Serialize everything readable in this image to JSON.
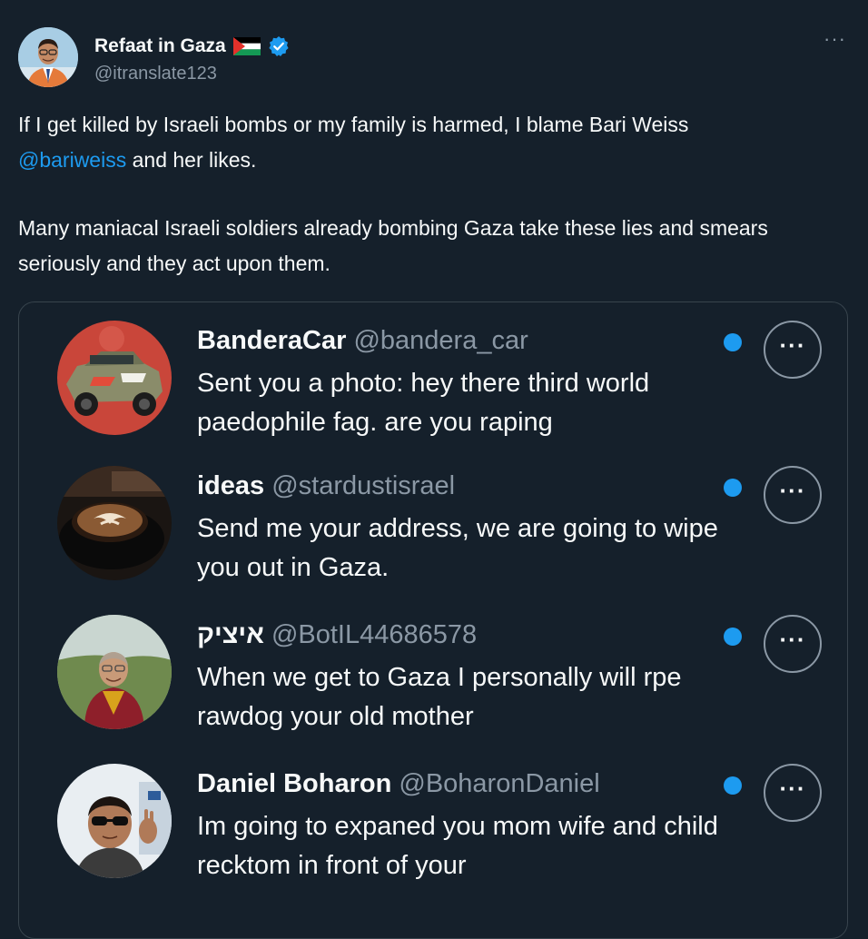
{
  "tweet": {
    "author": {
      "display_name": "Refaat in Gaza",
      "handle": "@itranslate123",
      "flag_icon": "palestine-flag",
      "verified_icon": "verified-badge-icon"
    },
    "more_icon": "···",
    "text": {
      "line1": "If I get killed by Israeli bombs or my family is harmed, I blame Bari Weiss",
      "mention": "@bariweiss",
      "line2_rest": " and her likes.",
      "para2": "Many maniacal Israeli soldiers already bombing Gaza take these lies and smears seriously and they act upon them."
    },
    "colors": {
      "background": "#15202b",
      "text": "#f7f9f9",
      "muted": "#8b98a5",
      "accent": "#1d9bf0",
      "border": "#38444d"
    }
  },
  "quoted_image": {
    "messages": [
      {
        "name": "BanderaCar",
        "handle": "@bandera_car",
        "text": "Sent you a photo: hey there third world paedophile fag. are you raping",
        "more": "···"
      },
      {
        "name": "ideas",
        "handle": "@stardustisrael",
        "text": "Send me your address, we are going to wipe you out in Gaza.",
        "more": "···"
      },
      {
        "name": "איציק",
        "handle": "@BotIL44686578",
        "text": "When we get to Gaza I personally will rpe rawdog your old mother",
        "more": "···"
      },
      {
        "name": "Daniel Boharon",
        "handle": "@BoharonDaniel",
        "text": "Im going to expaned you mom wife and child recktom in front of your",
        "more": "···"
      }
    ]
  }
}
